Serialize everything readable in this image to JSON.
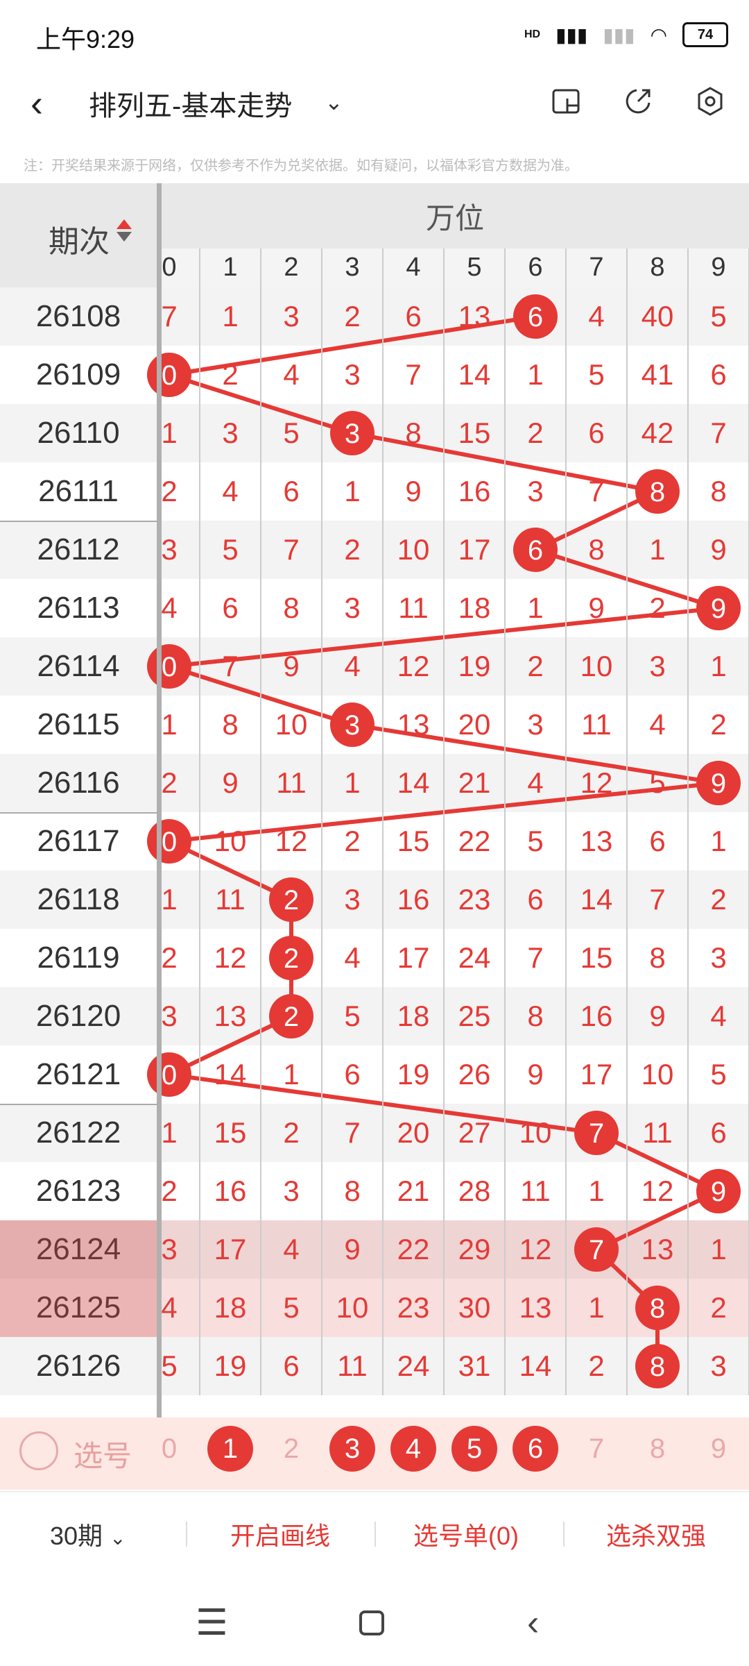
{
  "status_bar": {
    "time": "上午9:29",
    "signal_label": "HD",
    "battery": "74"
  },
  "header": {
    "title": "排列五-基本走势"
  },
  "disclaimer": "注：开奖结果来源于网络，仅供参考不作为兑奖依据。如有疑问，以福体彩官方数据为准。",
  "table": {
    "issue_header": "期次",
    "group_header": "万位",
    "digit_headers": [
      "0",
      "1",
      "2",
      "3",
      "4",
      "5",
      "6",
      "7",
      "8",
      "9"
    ],
    "rows": [
      {
        "issue": "26108",
        "cells": [
          "7",
          "1",
          "3",
          "2",
          "6",
          "13",
          "6",
          "4",
          "40",
          "5"
        ],
        "hit": 6
      },
      {
        "issue": "26109",
        "cells": [
          "0",
          "2",
          "4",
          "3",
          "7",
          "14",
          "1",
          "5",
          "41",
          "6"
        ],
        "hit": 0
      },
      {
        "issue": "26110",
        "cells": [
          "1",
          "3",
          "5",
          "3",
          "8",
          "15",
          "2",
          "6",
          "42",
          "7"
        ],
        "hit": 3
      },
      {
        "issue": "26111",
        "cells": [
          "2",
          "4",
          "6",
          "1",
          "9",
          "16",
          "3",
          "7",
          "8",
          "8"
        ],
        "hit": 8
      },
      {
        "issue": "26112",
        "cells": [
          "3",
          "5",
          "7",
          "2",
          "10",
          "17",
          "6",
          "8",
          "1",
          "9"
        ],
        "hit": 6
      },
      {
        "issue": "26113",
        "cells": [
          "4",
          "6",
          "8",
          "3",
          "11",
          "18",
          "1",
          "9",
          "2",
          "9"
        ],
        "hit": 9
      },
      {
        "issue": "26114",
        "cells": [
          "0",
          "7",
          "9",
          "4",
          "12",
          "19",
          "2",
          "10",
          "3",
          "1"
        ],
        "hit": 0
      },
      {
        "issue": "26115",
        "cells": [
          "1",
          "8",
          "10",
          "3",
          "13",
          "20",
          "3",
          "11",
          "4",
          "2"
        ],
        "hit": 3
      },
      {
        "issue": "26116",
        "cells": [
          "2",
          "9",
          "11",
          "1",
          "14",
          "21",
          "4",
          "12",
          "5",
          "9"
        ],
        "hit": 9
      },
      {
        "issue": "26117",
        "cells": [
          "0",
          "10",
          "12",
          "2",
          "15",
          "22",
          "5",
          "13",
          "6",
          "1"
        ],
        "hit": 0
      },
      {
        "issue": "26118",
        "cells": [
          "1",
          "11",
          "2",
          "3",
          "16",
          "23",
          "6",
          "14",
          "7",
          "2"
        ],
        "hit": 2
      },
      {
        "issue": "26119",
        "cells": [
          "2",
          "12",
          "2",
          "4",
          "17",
          "24",
          "7",
          "15",
          "8",
          "3"
        ],
        "hit": 2
      },
      {
        "issue": "26120",
        "cells": [
          "3",
          "13",
          "2",
          "5",
          "18",
          "25",
          "8",
          "16",
          "9",
          "4"
        ],
        "hit": 2
      },
      {
        "issue": "26121",
        "cells": [
          "0",
          "14",
          "1",
          "6",
          "19",
          "26",
          "9",
          "17",
          "10",
          "5"
        ],
        "hit": 0
      },
      {
        "issue": "26122",
        "cells": [
          "1",
          "15",
          "2",
          "7",
          "20",
          "27",
          "10",
          "7",
          "11",
          "6"
        ],
        "hit": 7
      },
      {
        "issue": "26123",
        "cells": [
          "2",
          "16",
          "3",
          "8",
          "21",
          "28",
          "11",
          "1",
          "12",
          "9"
        ],
        "hit": 9
      },
      {
        "issue": "26124",
        "cells": [
          "3",
          "17",
          "4",
          "9",
          "22",
          "29",
          "12",
          "7",
          "13",
          "1"
        ],
        "hit": 7
      },
      {
        "issue": "26125",
        "cells": [
          "4",
          "18",
          "5",
          "10",
          "23",
          "30",
          "13",
          "1",
          "8",
          "2"
        ],
        "hit": 8
      },
      {
        "issue": "26126",
        "cells": [
          "5",
          "19",
          "6",
          "11",
          "24",
          "31",
          "14",
          "2",
          "8",
          "3"
        ],
        "hit": 8
      }
    ]
  },
  "select_row": {
    "label": "选号",
    "numbers": [
      "0",
      "1",
      "2",
      "3",
      "4",
      "5",
      "6",
      "7",
      "8",
      "9"
    ],
    "selected": [
      1,
      3,
      4,
      5,
      6
    ]
  },
  "toolbar": {
    "period": "30期",
    "draw_lines": "开启画线",
    "pick_list": "选号单(0)",
    "filter": "选杀双强"
  },
  "colors": {
    "accent": "#e53935"
  }
}
